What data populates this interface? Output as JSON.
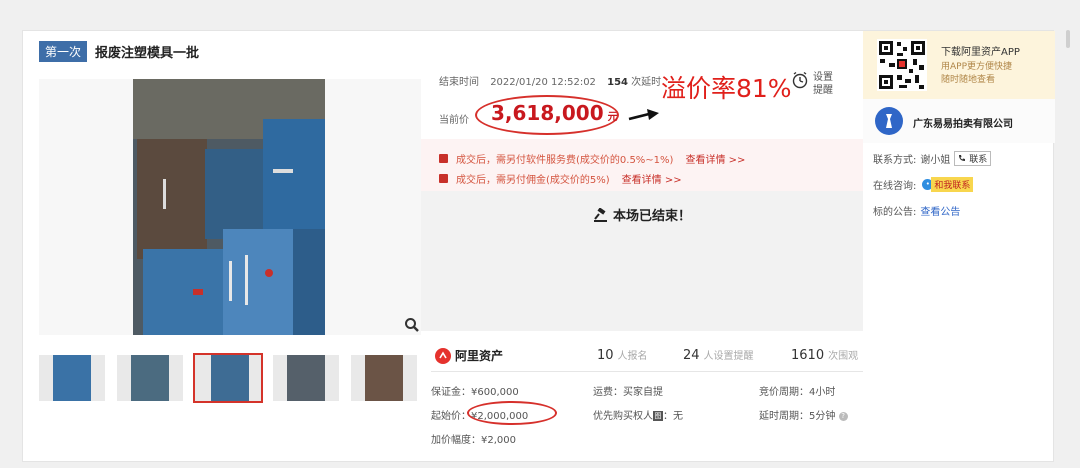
{
  "lot": {
    "round_tag": "第一次",
    "title": "报废注塑模具一批"
  },
  "auction": {
    "end_label": "结束时间",
    "end_time": "2022/01/20 12:52:02",
    "delays_count": "154",
    "delays_label": "次延时",
    "markup_annotation": "溢价率81%",
    "remind_label": "设置提醒",
    "price_label": "当前价",
    "current_price": "3,618,000",
    "price_unit": "元",
    "notice_fee": "成交后，需另付软件服务费(成交价的0.5%~1%)",
    "notice_fee_link": "查看详情 >>",
    "notice_commission": "成交后，需另付佣金(成交价的5%)",
    "notice_commission_link": "查看详情 >>",
    "ended_text": "本场已结束！"
  },
  "platform": {
    "name": "阿里资产",
    "signups": "10",
    "signups_label": "人报名",
    "reminders": "24",
    "reminders_label": "人设置提醒",
    "views": "1610",
    "views_label": "次围观"
  },
  "terms": {
    "deposit": "保证金：¥600,000",
    "shipping": "运费：买家自提",
    "bid_cycle": "竞价周期：4小时",
    "start_label": "起始价：",
    "start_price": "¥2,000,000",
    "priority_label": "优先购买权人",
    "priority_icon_char": "图",
    "priority_value": "：无",
    "delay_cycle": "延时周期：5分钟",
    "increment": "加价幅度：¥2,000"
  },
  "sidebar": {
    "app_title": "下载阿里资产APP",
    "app_sub1": "用APP更方便快捷",
    "app_sub2": "随时随地查看",
    "company": "广东易易拍卖有限公司",
    "contact_label": "联系方式:",
    "contact_name": "谢小姐",
    "contact_btn": "联系",
    "consult_label": "在线咨询:",
    "consult_btn": "和我联系",
    "announce_label": "标的公告:",
    "announce_link": "查看公告"
  },
  "colors": {
    "accent_red": "#d6302b",
    "price_red": "#c8181e",
    "tag_blue": "#3e6ea8",
    "link_blue": "#2f66c7"
  }
}
